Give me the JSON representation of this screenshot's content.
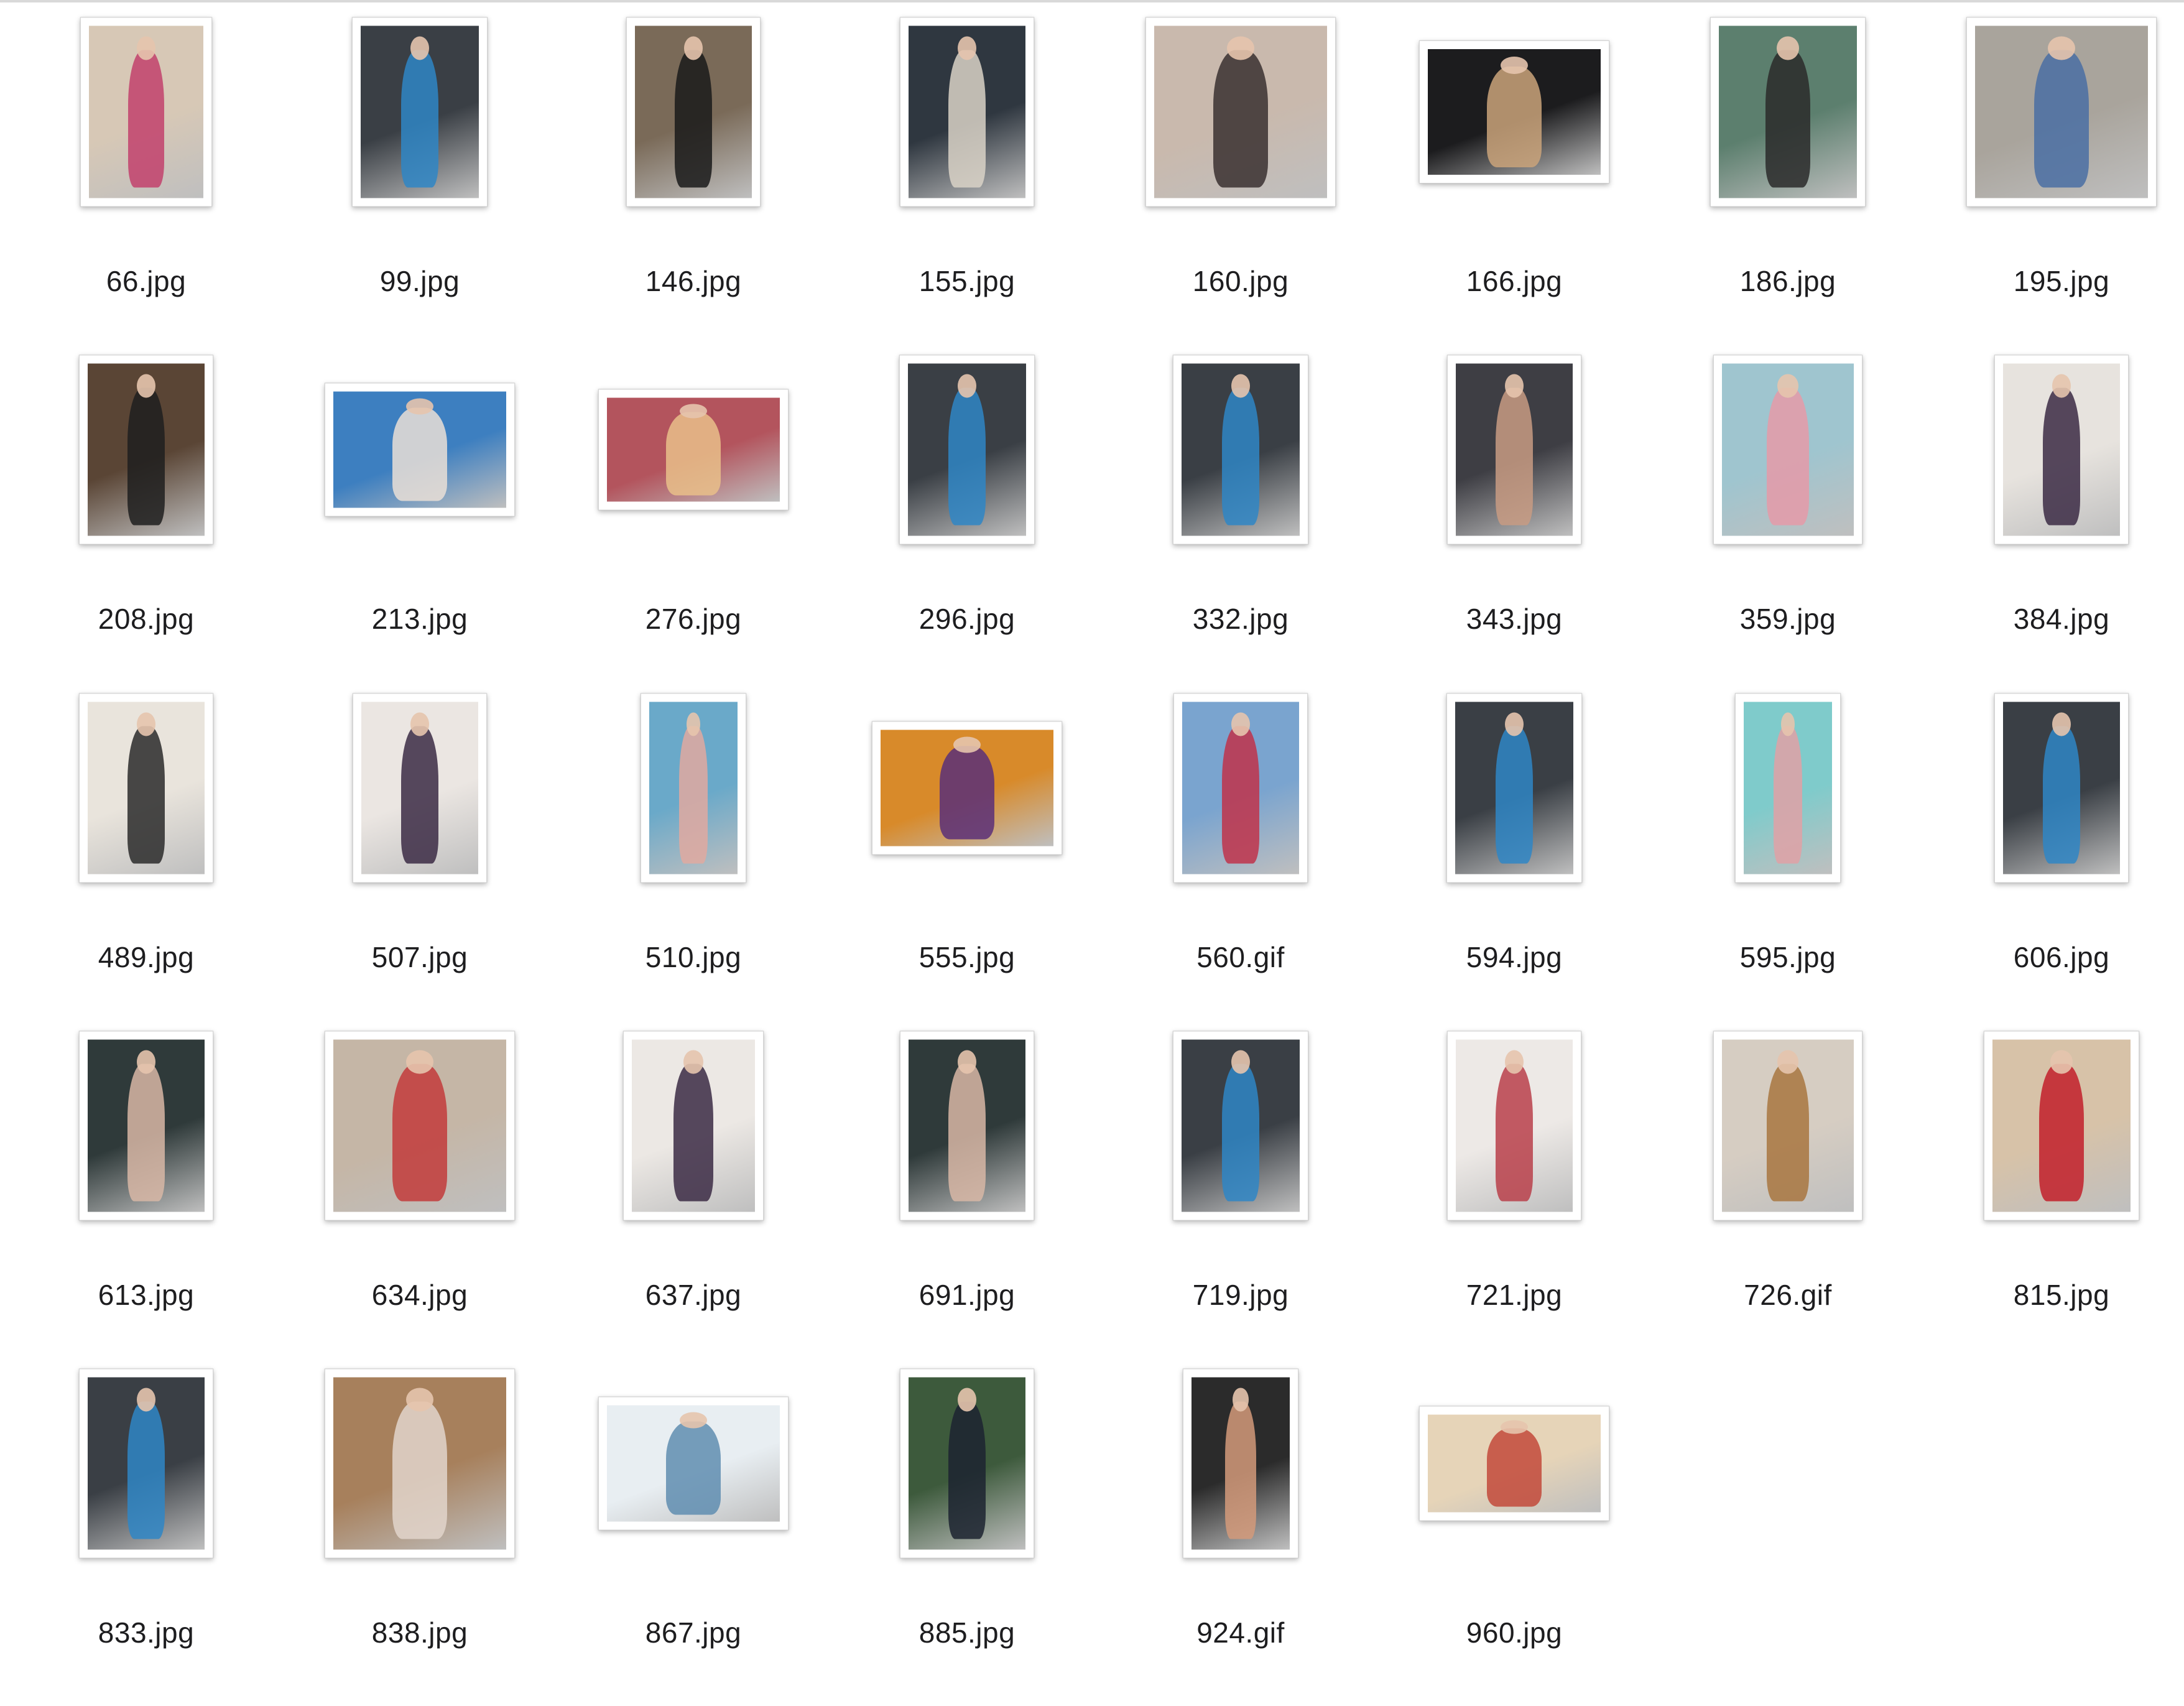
{
  "files": [
    {
      "name": "66.jpg",
      "bg": "#d7c8b6",
      "fg": "#c2416c"
    },
    {
      "name": "99.jpg",
      "bg": "#3a3f45",
      "fg": "#2f86c6"
    },
    {
      "name": "146.jpg",
      "bg": "#7a6a58",
      "fg": "#1a1a1a"
    },
    {
      "name": "155.jpg",
      "bg": "#2f3740",
      "fg": "#d9d2c7"
    },
    {
      "name": "160.jpg",
      "bg": "#c9b9ad",
      "fg": "#3a3030"
    },
    {
      "name": "166.jpg",
      "bg": "#1c1c1e",
      "fg": "#caa37a"
    },
    {
      "name": "186.jpg",
      "bg": "#5c7f6e",
      "fg": "#2a2a2a"
    },
    {
      "name": "195.jpg",
      "bg": "#a9a49c",
      "fg": "#4a6fa3"
    },
    {
      "name": "208.jpg",
      "bg": "#5a4535",
      "fg": "#1e1e1e"
    },
    {
      "name": "213.jpg",
      "bg": "#3d7fc0",
      "fg": "#eadfd6"
    },
    {
      "name": "276.jpg",
      "bg": "#b3545d",
      "fg": "#e9c08a"
    },
    {
      "name": "296.jpg",
      "bg": "#3a3f45",
      "fg": "#2f86c6"
    },
    {
      "name": "332.jpg",
      "bg": "#3a3f45",
      "fg": "#2f86c6"
    },
    {
      "name": "343.jpg",
      "bg": "#3e3e44",
      "fg": "#c89b82"
    },
    {
      "name": "359.jpg",
      "bg": "#9fc5cf",
      "fg": "#e59aa8"
    },
    {
      "name": "384.jpg",
      "bg": "#e7e3de",
      "fg": "#3b2a44"
    },
    {
      "name": "489.jpg",
      "bg": "#e9e4dc",
      "fg": "#2a2a2a"
    },
    {
      "name": "507.jpg",
      "bg": "#ebe6e2",
      "fg": "#3b2a44"
    },
    {
      "name": "510.jpg",
      "bg": "#6aa9c9",
      "fg": "#e1a9a0"
    },
    {
      "name": "555.jpg",
      "bg": "#d88a2a",
      "fg": "#5a2f78"
    },
    {
      "name": "560.gif",
      "bg": "#7aa4cf",
      "fg": "#c0334a"
    },
    {
      "name": "594.jpg",
      "bg": "#3a3f45",
      "fg": "#2f86c6"
    },
    {
      "name": "595.jpg",
      "bg": "#7fcbcb",
      "fg": "#e0a1a6"
    },
    {
      "name": "606.jpg",
      "bg": "#3a3f45",
      "fg": "#2f86c6"
    },
    {
      "name": "613.jpg",
      "bg": "#2f3a3a",
      "fg": "#d8b7a6"
    },
    {
      "name": "634.jpg",
      "bg": "#c5b6a6",
      "fg": "#c23b3b"
    },
    {
      "name": "637.jpg",
      "bg": "#ece8e4",
      "fg": "#3b2a44"
    },
    {
      "name": "691.jpg",
      "bg": "#2f3a3a",
      "fg": "#d8b7a6"
    },
    {
      "name": "719.jpg",
      "bg": "#3a3f45",
      "fg": "#2f86c6"
    },
    {
      "name": "721.jpg",
      "bg": "#ede9e6",
      "fg": "#b8404a"
    },
    {
      "name": "726.gif",
      "bg": "#d6cdc2",
      "fg": "#a8763f"
    },
    {
      "name": "815.jpg",
      "bg": "#d7c2a8",
      "fg": "#c21f2a"
    },
    {
      "name": "833.jpg",
      "bg": "#3a3f45",
      "fg": "#2f86c6"
    },
    {
      "name": "838.jpg",
      "bg": "#a7805c",
      "fg": "#e2d5cb"
    },
    {
      "name": "867.jpg",
      "bg": "#e8eef2",
      "fg": "#5f8db0"
    },
    {
      "name": "885.jpg",
      "bg": "#3d5a3c",
      "fg": "#1c2330"
    },
    {
      "name": "924.gif",
      "bg": "#2b2b2b",
      "fg": "#d39a7a"
    },
    {
      "name": "960.jpg",
      "bg": "#e6d4b8",
      "fg": "#c2493a"
    }
  ]
}
